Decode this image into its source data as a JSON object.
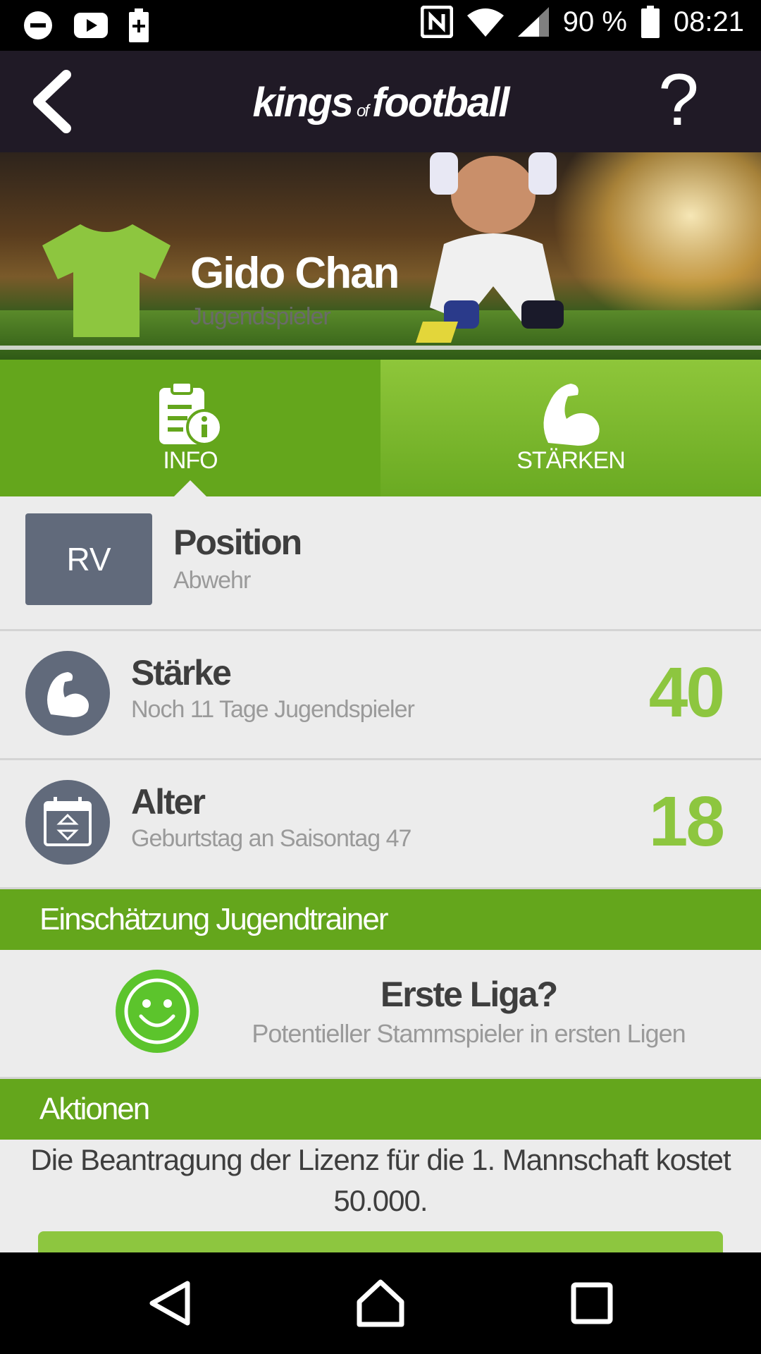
{
  "status_bar": {
    "battery": "90 %",
    "time": "08:21",
    "icons": [
      "do-not-disturb-icon",
      "youtube-icon",
      "battery-saver-icon",
      "nfc-icon",
      "wifi-icon",
      "signal-icon",
      "battery-icon"
    ]
  },
  "header": {
    "logo_main1": "kings",
    "logo_of": "of",
    "logo_main2": "football",
    "help_label": "?"
  },
  "player": {
    "name": "Gido Chan",
    "subtitle": "Jugendspieler"
  },
  "tabs": [
    {
      "label": "INFO",
      "icon": "clipboard-info-icon",
      "active": true
    },
    {
      "label": "STÄRKEN",
      "icon": "bicep-icon",
      "active": false
    }
  ],
  "position": {
    "badge": "RV",
    "title": "Position",
    "subtitle": "Abwehr"
  },
  "staerke": {
    "title": "Stärke",
    "subtitle": "Noch 11 Tage Jugendspieler",
    "value": "40"
  },
  "alter": {
    "title": "Alter",
    "subtitle": "Geburtstag an Saisontag 47",
    "value": "18"
  },
  "assessment": {
    "header": "Einschätzung Jugendtrainer",
    "title": "Erste Liga?",
    "subtitle": "Potentieller Stammspieler in ersten Ligen"
  },
  "actions": {
    "header": "Aktionen",
    "text": "Die Beantragung der Lizenz für die 1. Mannschaft kostet 50.000."
  },
  "colors": {
    "green_dark": "#64a61c",
    "green_light": "#8dc63f",
    "badge_gray": "#616a7b",
    "header_bg": "#201a26"
  }
}
